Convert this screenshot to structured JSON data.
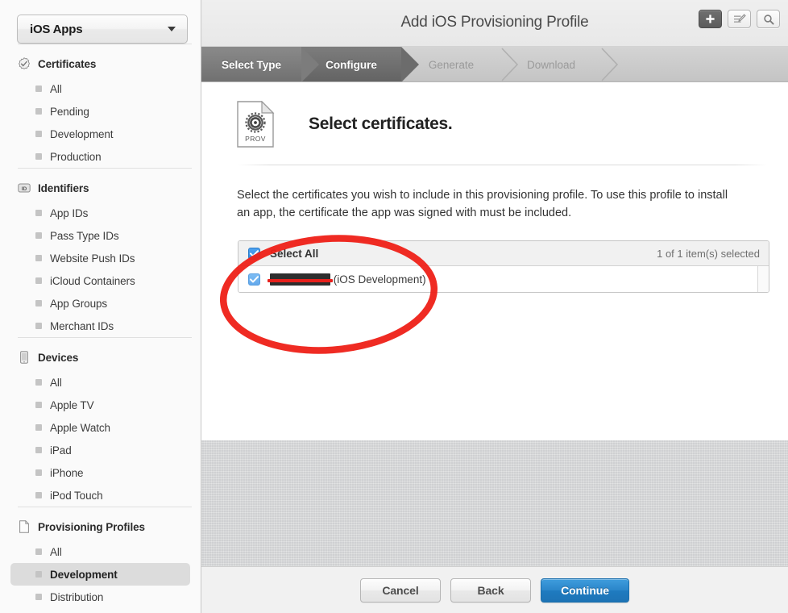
{
  "sidebar": {
    "team_selector": {
      "value": "iOS Apps",
      "icon": "chevron-down-icon"
    },
    "sections": [
      {
        "title": "Certificates",
        "icon": "certificate-seal-icon",
        "items": [
          {
            "label": "All",
            "selected": false
          },
          {
            "label": "Pending",
            "selected": false
          },
          {
            "label": "Development",
            "selected": false
          },
          {
            "label": "Production",
            "selected": false
          }
        ]
      },
      {
        "title": "Identifiers",
        "icon": "id-badge-icon",
        "items": [
          {
            "label": "App IDs",
            "selected": false
          },
          {
            "label": "Pass Type IDs",
            "selected": false
          },
          {
            "label": "Website Push IDs",
            "selected": false
          },
          {
            "label": "iCloud Containers",
            "selected": false
          },
          {
            "label": "App Groups",
            "selected": false
          },
          {
            "label": "Merchant IDs",
            "selected": false
          }
        ]
      },
      {
        "title": "Devices",
        "icon": "device-phone-icon",
        "items": [
          {
            "label": "All",
            "selected": false
          },
          {
            "label": "Apple TV",
            "selected": false
          },
          {
            "label": "Apple Watch",
            "selected": false
          },
          {
            "label": "iPad",
            "selected": false
          },
          {
            "label": "iPhone",
            "selected": false
          },
          {
            "label": "iPod Touch",
            "selected": false
          }
        ]
      },
      {
        "title": "Provisioning Profiles",
        "icon": "document-icon",
        "items": [
          {
            "label": "All",
            "selected": false
          },
          {
            "label": "Development",
            "selected": true
          },
          {
            "label": "Distribution",
            "selected": false
          }
        ]
      }
    ]
  },
  "topbar": {
    "title": "Add iOS Provisioning Profile",
    "buttons": [
      {
        "name": "add-button",
        "icon": "plus-icon",
        "active": true
      },
      {
        "name": "edit-button",
        "icon": "edit-list-icon",
        "active": false
      },
      {
        "name": "search-button",
        "icon": "search-icon",
        "active": false
      }
    ]
  },
  "steps": [
    {
      "label": "Select Type",
      "state": "complete"
    },
    {
      "label": "Configure",
      "state": "current"
    },
    {
      "label": "Generate",
      "state": "upcoming"
    },
    {
      "label": "Download",
      "state": "upcoming"
    }
  ],
  "content": {
    "icon_label": "PROV",
    "icon_name": "provisioning-profile-icon",
    "heading": "Select certificates.",
    "description": "Select the certificates you wish to include in this provisioning profile. To use this profile to install an app, the certificate the app was signed with must be included.",
    "table": {
      "select_all_label": "Select All",
      "select_all_checked": true,
      "selection_count": "1 of 1 item(s) selected",
      "rows": [
        {
          "checked": true,
          "redacted_name": "REDACTED",
          "suffix": "(iOS Development)"
        }
      ]
    }
  },
  "footer": {
    "buttons": [
      {
        "label": "Cancel",
        "style": "plain"
      },
      {
        "label": "Back",
        "style": "plain"
      },
      {
        "label": "Continue",
        "style": "primary"
      }
    ]
  },
  "annotation": {
    "type": "ellipse-highlight",
    "color": "#ee2017"
  }
}
